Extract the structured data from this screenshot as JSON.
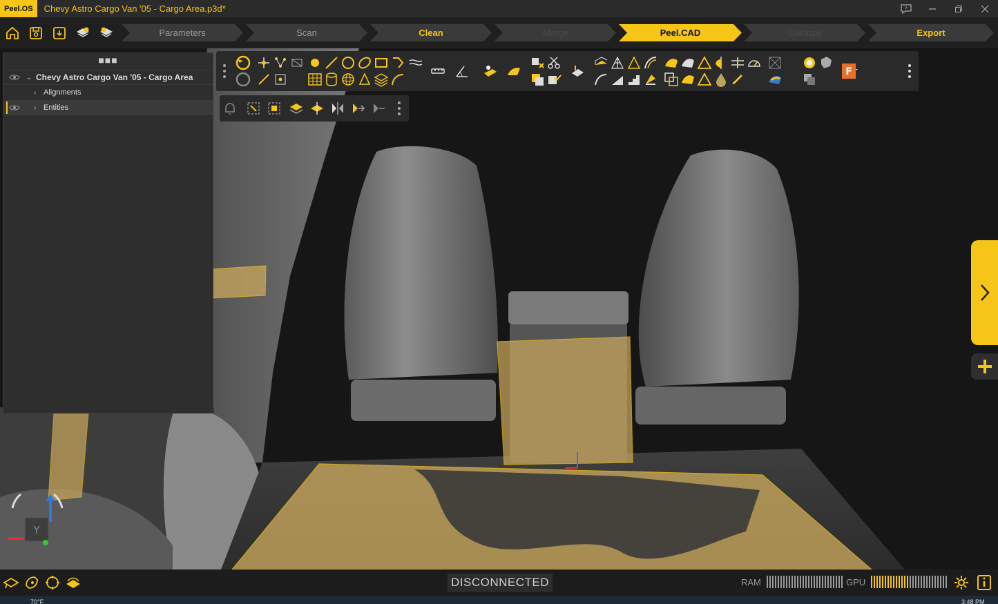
{
  "titlebar": {
    "app_badge": "Peel.OS",
    "document_title": "Chevy Astro Cargo Van '05 - Cargo Area.p3d*"
  },
  "workflow": {
    "steps": [
      {
        "label": "Parameters",
        "state": "inactive"
      },
      {
        "label": "Scan",
        "state": "inactive"
      },
      {
        "label": "Clean",
        "state": "highlight"
      },
      {
        "label": "Merge",
        "state": "disabled"
      },
      {
        "label": "Peel.CAD",
        "state": "current"
      },
      {
        "label": "Colorize",
        "state": "disabled"
      },
      {
        "label": "Export",
        "state": "highlight"
      }
    ]
  },
  "panel": {
    "root_label": "Chevy Astro Cargo Van '05 - Cargo Area",
    "children": [
      {
        "label": "Alignments"
      },
      {
        "label": "Entities"
      }
    ]
  },
  "viewcube": {
    "axis_label": "Y"
  },
  "status": {
    "connection": "DISCONNECTED",
    "ram_label": "RAM",
    "gpu_label": "GPU",
    "ram_level": 1.0,
    "gpu_level": 0.5
  },
  "taskbar": {
    "temp": "70°F",
    "time": "3:48 PM"
  },
  "colors": {
    "accent": "#f5c518",
    "panel_bg": "#2e2e2e",
    "toolbar_bg": "#2a2a2a"
  }
}
